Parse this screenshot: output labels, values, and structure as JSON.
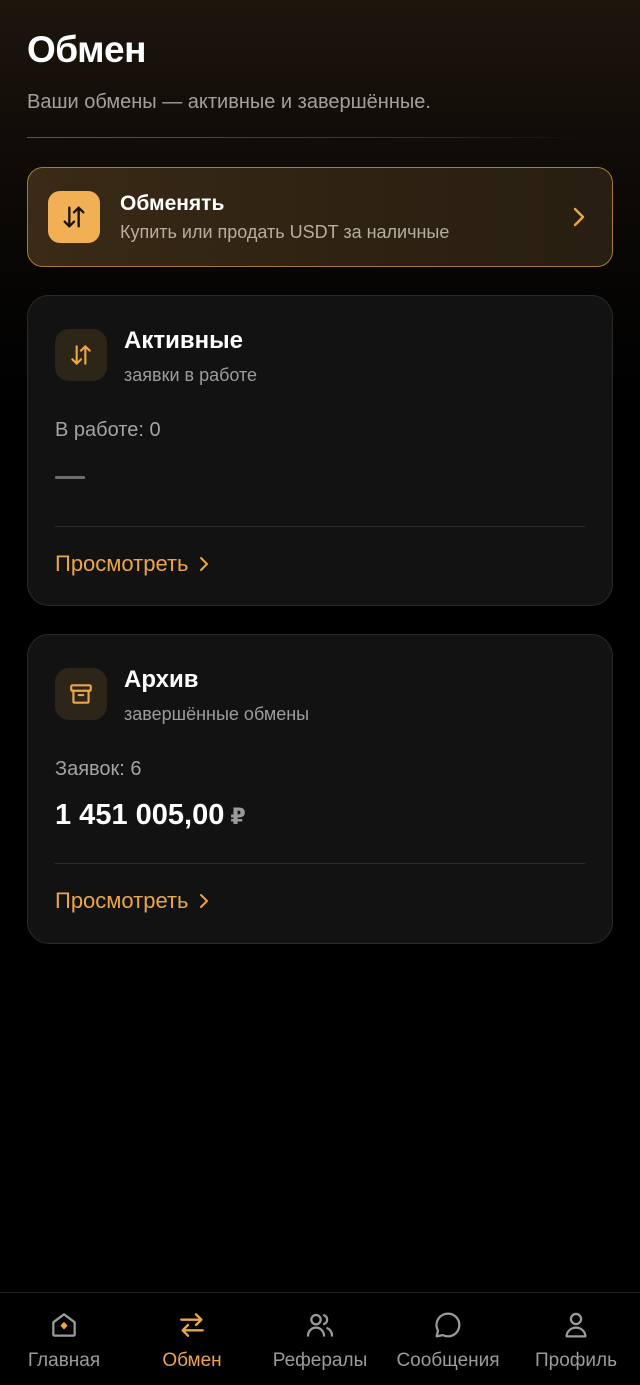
{
  "header": {
    "title": "Обмен",
    "subtitle": "Ваши обмены — активные и завершённые."
  },
  "exchange_card": {
    "title": "Обменять",
    "subtitle": "Купить или продать USDT за наличные"
  },
  "active_card": {
    "title": "Активные",
    "subtitle": "заявки в работе",
    "count_label": "В работе: 0",
    "link_label": "Просмотреть"
  },
  "archive_card": {
    "title": "Архив",
    "subtitle": "завершённые обмены",
    "count_label": "Заявок: 6",
    "amount": "1 451 005,00",
    "currency": "₽",
    "link_label": "Просмотреть"
  },
  "tabbar": {
    "items": [
      {
        "label": "Главная",
        "icon": "home-icon",
        "active": false
      },
      {
        "label": "Обмен",
        "icon": "exchange-arrows-icon",
        "active": true
      },
      {
        "label": "Рефералы",
        "icon": "users-icon",
        "active": false
      },
      {
        "label": "Сообщения",
        "icon": "chat-bubble-icon",
        "active": false
      },
      {
        "label": "Профиль",
        "icon": "user-icon",
        "active": false
      }
    ]
  },
  "colors": {
    "accent": "#eba54b",
    "accent_fill": "#f1b054",
    "card_bg": "#121212",
    "muted_text": "#9c9c9c"
  }
}
